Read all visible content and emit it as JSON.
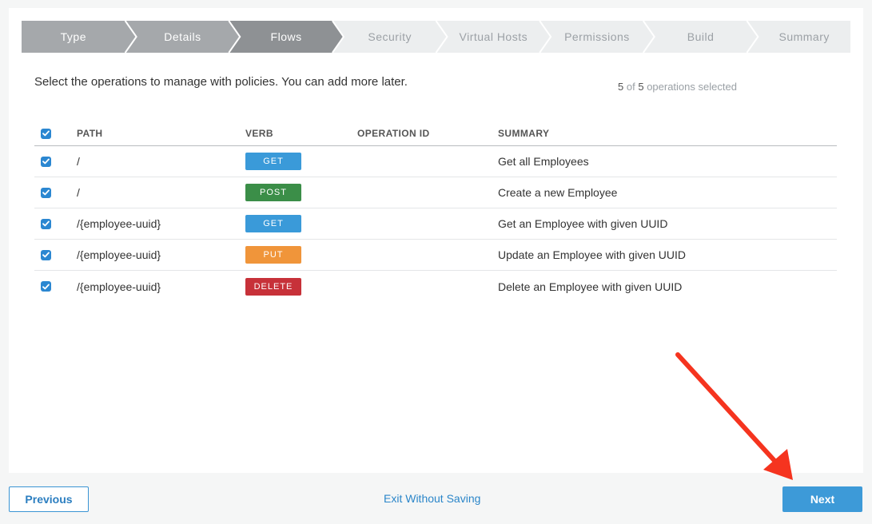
{
  "wizard": {
    "steps": [
      {
        "label": "Type",
        "state": "done"
      },
      {
        "label": "Details",
        "state": "done"
      },
      {
        "label": "Flows",
        "state": "current"
      },
      {
        "label": "Security",
        "state": "todo"
      },
      {
        "label": "Virtual Hosts",
        "state": "todo"
      },
      {
        "label": "Permissions",
        "state": "todo"
      },
      {
        "label": "Build",
        "state": "todo"
      },
      {
        "label": "Summary",
        "state": "todo"
      }
    ],
    "colors": {
      "done": "#a5a8ab",
      "current": "#8e9194",
      "todo": "#eceeef",
      "separator": "#ffffff"
    }
  },
  "intro": "Select the operations to manage with policies. You can add more later.",
  "counter": {
    "selected": "5",
    "of_word": "of",
    "total": "5",
    "suffix": "operations selected"
  },
  "table": {
    "headers": {
      "path": "PATH",
      "verb": "VERB",
      "operation_id": "OPERATION ID",
      "summary": "SUMMARY"
    },
    "header_checked": true,
    "rows": [
      {
        "checked": true,
        "path": "/",
        "verb": "GET",
        "verb_color": "#3a9ad9",
        "operation_id": "",
        "summary": "Get all Employees"
      },
      {
        "checked": true,
        "path": "/",
        "verb": "POST",
        "verb_color": "#3b8e48",
        "operation_id": "",
        "summary": "Create a new Employee"
      },
      {
        "checked": true,
        "path": "/{employee-uuid}",
        "verb": "GET",
        "verb_color": "#3a9ad9",
        "operation_id": "",
        "summary": "Get an Employee with given UUID"
      },
      {
        "checked": true,
        "path": "/{employee-uuid}",
        "verb": "PUT",
        "verb_color": "#f0953a",
        "operation_id": "",
        "summary": "Update an Employee with given UUID"
      },
      {
        "checked": true,
        "path": "/{employee-uuid}",
        "verb": "DELETE",
        "verb_color": "#c73139",
        "operation_id": "",
        "summary": "Delete an Employee with given UUID"
      }
    ]
  },
  "footer": {
    "previous_label": "Previous",
    "exit_label": "Exit Without Saving",
    "next_label": "Next"
  },
  "annotation": {
    "arrow_color": "#f5341f"
  }
}
